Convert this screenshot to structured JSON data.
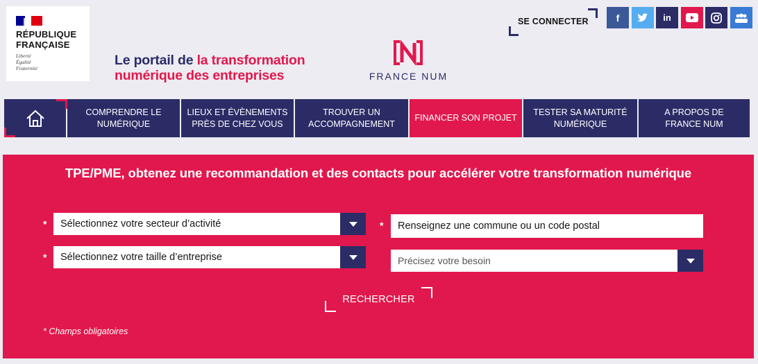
{
  "header": {
    "republic": {
      "name_line1": "RÉPUBLIQUE",
      "name_line2": "FRANÇAISE",
      "motto_line1": "Liberté",
      "motto_line2": "Égalité",
      "motto_line3": "Fraternité"
    },
    "tagline_part1": "Le portail de ",
    "tagline_accent": "la transformation",
    "tagline_part2": "numérique des entreprises",
    "logo_text": "FRANCE NUM",
    "connect_label": "SE CONNECTER",
    "socials": [
      {
        "icon": "facebook-icon",
        "glyph": "f",
        "color": "#3b5998"
      },
      {
        "icon": "twitter-icon",
        "glyph": "t",
        "color": "#55acee"
      },
      {
        "icon": "linkedin-icon",
        "glyph": "in",
        "color": "#2b2c66"
      },
      {
        "icon": "youtube-icon",
        "glyph": "▶",
        "color": "#e1184d"
      },
      {
        "icon": "instagram-icon",
        "glyph": "◎",
        "color": "#2b2c66"
      },
      {
        "icon": "community-icon",
        "glyph": "👥",
        "color": "#3a7bd5"
      }
    ]
  },
  "nav": {
    "home_icon": "home-icon",
    "items": [
      {
        "line1": "COMPRENDRE LE",
        "line2": "NUMÉRIQUE"
      },
      {
        "line1": "LIEUX ET ÉVÈNEMENTS",
        "line2": "PRÈS DE CHEZ VOUS"
      },
      {
        "line1": "TROUVER UN",
        "line2": "ACCOMPAGNEMENT"
      },
      {
        "line1": "FINANCER SON PROJET",
        "line2": ""
      },
      {
        "line1": "TESTER SA MATURITÉ",
        "line2": "NUMÉRIQUE"
      },
      {
        "line1": "A PROPOS DE",
        "line2": "FRANCE NUM"
      }
    ],
    "active_index": 3
  },
  "search": {
    "title": "TPE/PME, obtenez une recommandation et des contacts pour accélérer votre transformation numérique",
    "required_mark": "*",
    "sector_select": "Sélectionnez votre secteur d’activité",
    "size_select": "Sélectionnez votre taille d’entreprise",
    "location_input": "Renseignez une commune ou un code postal",
    "need_select": "Précisez votre besoin",
    "submit_label": "RECHERCHER",
    "footnote": "* Champs obligatoires"
  },
  "colors": {
    "navy": "#2b2c66",
    "accent": "#e1184d",
    "background": "#ececf2"
  }
}
